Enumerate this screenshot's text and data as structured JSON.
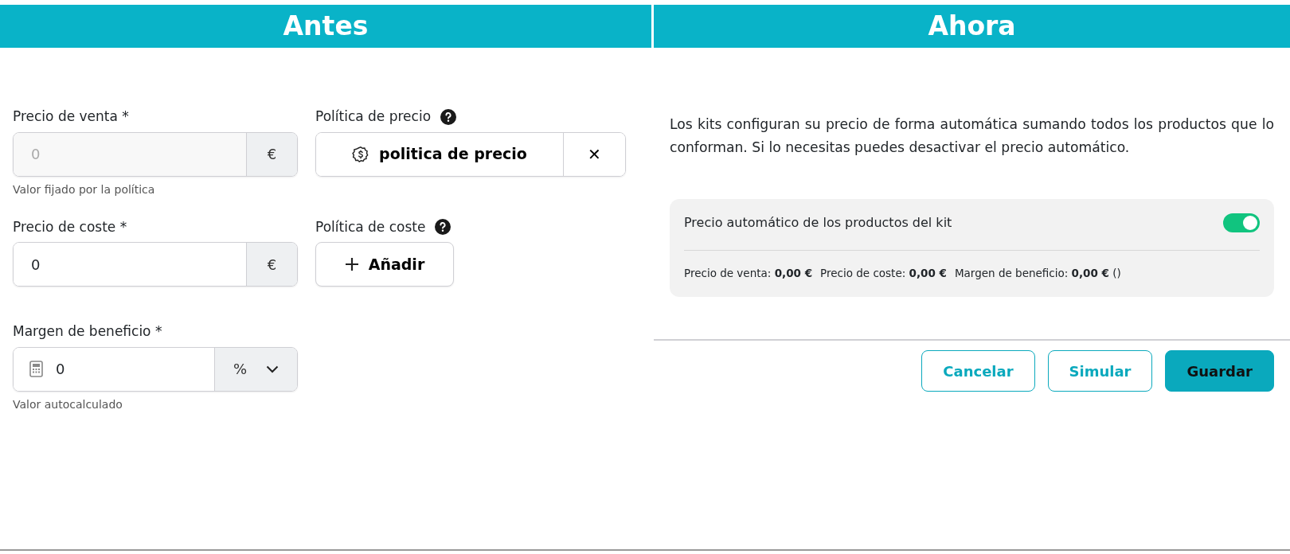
{
  "panels": [
    {
      "title": "Antes"
    },
    {
      "title": "Ahora"
    }
  ],
  "before": {
    "sale_price": {
      "label": "Precio de venta *",
      "value": "0",
      "disabled": true,
      "addon": "€",
      "help": "Valor fijado por la política"
    },
    "price_policy": {
      "label": "Política de precio",
      "value": "politica de precio",
      "clear": "✕"
    },
    "cost_price": {
      "label": "Precio de coste *",
      "value": "0",
      "disabled": false,
      "addon": "€"
    },
    "cost_policy": {
      "label": "Política de coste",
      "button": "Añadir"
    },
    "margin": {
      "label": "Margen de beneficio *",
      "value": "0",
      "unit": "%",
      "help": "Valor autocalculado"
    }
  },
  "after": {
    "description": "Los kits configuran su precio de forma automática sumando todos los productos que lo conforman. Si lo necesitas puedes desactivar el precio automático.",
    "auto_price": {
      "label": "Precio automático de los productos del kit",
      "on": true
    },
    "summary": [
      "Precio de venta: **0,00 €**",
      "Precio de coste: **0,00 €**",
      "Margen de beneficio: **0,00 €** ()"
    ],
    "buttons": [
      {
        "label": "Cancelar",
        "kind": "outline"
      },
      {
        "label": "Simular",
        "kind": "outline"
      },
      {
        "label": "Guardar",
        "kind": "primary"
      }
    ]
  }
}
